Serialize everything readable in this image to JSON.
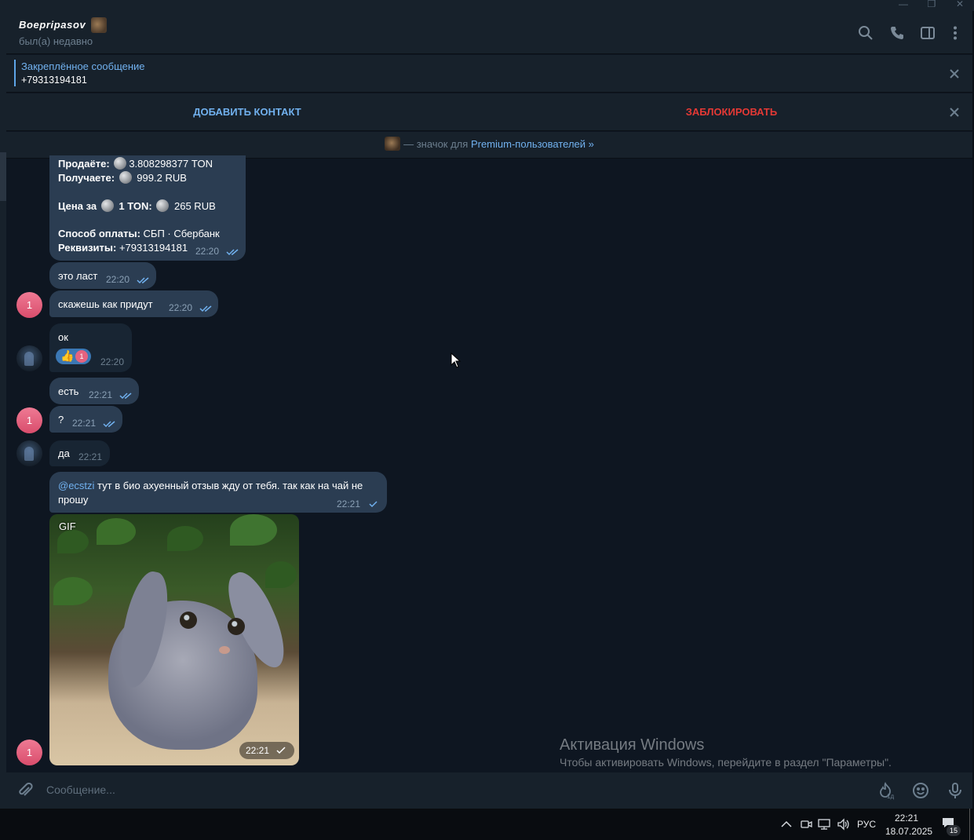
{
  "window": {
    "minimize_glyph": "—",
    "maximize_glyph": "❐",
    "close_glyph": "✕"
  },
  "header": {
    "name": "Boepripasov",
    "status": "был(а) недавно",
    "icons": [
      "search-icon",
      "phone-icon",
      "sidebar-toggle-icon",
      "more-vertical-icon"
    ]
  },
  "pinned": {
    "title": "Закреплённое сообщение",
    "text": "+79313194181"
  },
  "actions": {
    "add_contact": "ДОБАВИТЬ КОНТАКТ",
    "block": "ЗАБЛОКИРОВАТЬ"
  },
  "premium_banner": {
    "prefix": "— значок для",
    "link": "Premium-пользователей »"
  },
  "messages": {
    "order": {
      "sell_label": "Продаёте:",
      "sell_value": "3.808298377 TON",
      "receive_label": "Получаете:",
      "receive_value": "999.2 RUB",
      "price_label": "Цена за",
      "price_unit": "1 TON:",
      "price_value": "265 RUB",
      "method_label": "Способ оплаты:",
      "method_value": "СБП · Сбербанк",
      "details_label": "Реквизиты:",
      "details_value": "+79313194181",
      "time": "22:20"
    },
    "m1": {
      "text": "это ласт",
      "time": "22:20"
    },
    "m2": {
      "text": "скажешь как придут",
      "time": "22:20"
    },
    "m3": {
      "text": "ок",
      "time": "22:20",
      "reaction_emoji": "👍",
      "reaction_avatar": "1"
    },
    "m4": {
      "text": "есть",
      "time": "22:21"
    },
    "m5": {
      "text": "?",
      "time": "22:21"
    },
    "m6": {
      "text": "да",
      "time": "22:21"
    },
    "m7": {
      "mention": "@ecstzi",
      "text_line1": " тут в био ахуенный отзыв жду от тебя. так как на чай не",
      "text_line2": "прошу",
      "time": "22:21"
    },
    "gif": {
      "label": "GIF",
      "time": "22:21"
    }
  },
  "avatars": {
    "user_initial": "1"
  },
  "watermark": {
    "title": "Активация Windows",
    "text": "Чтобы активировать Windows, перейдите в раздел \"Параметры\"."
  },
  "composer": {
    "placeholder": "Сообщение...",
    "timer_label": "1д"
  },
  "taskbar": {
    "lang": "РУС",
    "time": "22:21",
    "date": "18.07.2025",
    "notifications": "15"
  },
  "colors": {
    "background": "#0e1621",
    "panel": "#17212b",
    "outgoing_bubble": "#2b3d52",
    "incoming_bubble": "#182533",
    "accent": "#71b1ef",
    "danger": "#e53935",
    "avatar_pink": "#e5637f"
  }
}
